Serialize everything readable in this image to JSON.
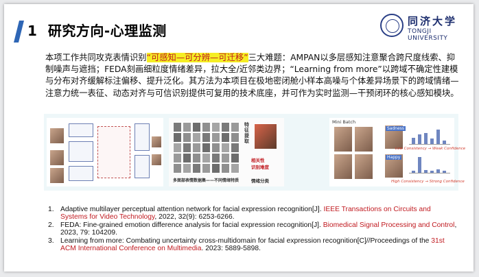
{
  "title": {
    "number": "1",
    "text": "研究方向-心理监测"
  },
  "logo": {
    "cn": "同济大学",
    "en": "TONGJI UNIVERSITY"
  },
  "intro": {
    "before": "本项工作共同攻克表情识别",
    "highlight": "“可感知—可分辨—可迁移”",
    "after": "三大难题：AMPAN以多层感知注意聚合跨尺度线索、抑制噪声与遮挡；FEDA刻画细粒度情绪差异，拉大全/近邻类边界；“Learning from more”以跨域不确定性建模与分布对齐缓解标注偏移、提升泛化。其方法为本项目在极地密闭舱小样本高噪与个体差异场景下的跨域情绪—注意力统一表征、动态对齐与可信识别提供可复用的技术底座，并可作为实时监测—干预闭环的核心感知模块。"
  },
  "figures": {
    "fig2": {
      "vert_label": "特征提取",
      "relevance": "相关性",
      "difficulty": "识别难度",
      "bottom_caption": "多面部表情数据集——不同情绪特质",
      "class_label": "情绪分类"
    },
    "fig3": {
      "mini_batch": "Mini Batch",
      "label_sadness": "Sadness",
      "label_happy": "Happy",
      "low_text": "Low Consistency → Weak Confidence",
      "high_text": "High Consistency → Strong Confidence",
      "bars_top": [
        0.35,
        0.55,
        0.6,
        0.3,
        0.8,
        0.2
      ],
      "bars_bottom": [
        0.1,
        0.9,
        0.15,
        0.1,
        0.2,
        0.1
      ]
    }
  },
  "refs": [
    {
      "num": "1.",
      "text": "Adaptive multilayer perceptual attention network for facial expression recognition[J]. ",
      "venue": "IEEE Transactions on Circuits and Systems for Video Technology",
      "tail": ", 2022, 32(9): 6253-6266."
    },
    {
      "num": "2.",
      "text": "FEDA: Fine-grained emotion difference analysis for facial expression recognition[J]. ",
      "venue": "Biomedical Signal Processing and Control",
      "tail": ", 2023, 79: 104209."
    },
    {
      "num": "3.",
      "text": "Learning from more: Combating uncertainty cross-multidomain for facial expression recognition[C]//Proceedings of the ",
      "venue": "31st ACM International Conference on Multimedia",
      "tail": ". 2023: 5889-5898."
    }
  ],
  "colors": {
    "accent": "#2e66b5",
    "highlight_bg": "#f5ee24",
    "highlight_text": "#c0191f",
    "venue": "#c0191f",
    "figure_band": "#eef7f9"
  }
}
